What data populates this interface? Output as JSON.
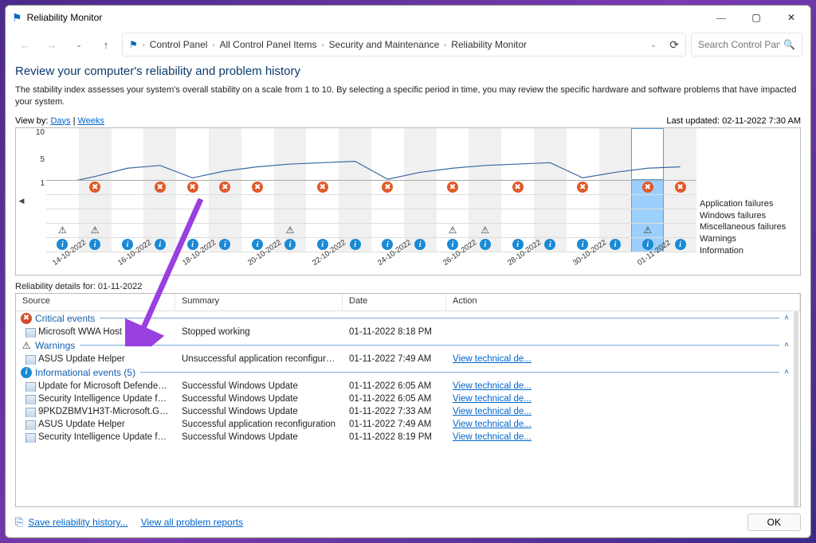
{
  "window": {
    "title": "Reliability Monitor"
  },
  "breadcrumb": [
    "Control Panel",
    "All Control Panel Items",
    "Security and Maintenance",
    "Reliability Monitor"
  ],
  "search": {
    "placeholder": "Search Control Panel"
  },
  "heading": "Review your computer's reliability and problem history",
  "description": "The stability index assesses your system's overall stability on a scale from 1 to 10. By selecting a specific period in time, you may review the specific hardware and software problems that have impacted your system.",
  "view_by_label": "View by:",
  "view_by_days": "Days",
  "view_by_weeks": "Weeks",
  "last_updated": "Last updated: 02-11-2022 7:30 AM",
  "legend": [
    "Application failures",
    "Windows failures",
    "Miscellaneous failures",
    "Warnings",
    "Information"
  ],
  "details_for": "Reliability details for: 01-11-2022",
  "columns": {
    "source": "Source",
    "summary": "Summary",
    "date": "Date",
    "action": "Action"
  },
  "groups": {
    "critical": "Critical events",
    "warnings": "Warnings",
    "info": "Informational events (5)"
  },
  "rows": {
    "critical": [
      {
        "source": "Microsoft WWA Host",
        "summary": "Stopped working",
        "date": "01-11-2022 8:18 PM",
        "action": ""
      }
    ],
    "warnings": [
      {
        "source": "ASUS Update Helper",
        "summary": "Unsuccessful application reconfiguration",
        "date": "01-11-2022 7:49 AM",
        "action": "View technical de..."
      }
    ],
    "info": [
      {
        "source": "Update for Microsoft Defender An...",
        "summary": "Successful Windows Update",
        "date": "01-11-2022 6:05 AM",
        "action": "View technical de..."
      },
      {
        "source": "Security Intelligence Update for M...",
        "summary": "Successful Windows Update",
        "date": "01-11-2022 6:05 AM",
        "action": "View technical de..."
      },
      {
        "source": "9PKDZBMV1H3T-Microsoft.GetHelp",
        "summary": "Successful Windows Update",
        "date": "01-11-2022 7:33 AM",
        "action": "View technical de..."
      },
      {
        "source": "ASUS Update Helper",
        "summary": "Successful application reconfiguration",
        "date": "01-11-2022 7:49 AM",
        "action": "View technical de..."
      },
      {
        "source": "Security Intelligence Update for M...",
        "summary": "Successful Windows Update",
        "date": "01-11-2022 8:19 PM",
        "action": "View technical de..."
      }
    ]
  },
  "footer": {
    "save": "Save reliability history...",
    "viewall": "View all problem reports",
    "ok": "OK"
  },
  "chart_data": {
    "type": "line",
    "dates": [
      "14-10-2022",
      "",
      "16-10-2022",
      "",
      "18-10-2022",
      "",
      "20-10-2022",
      "",
      "22-10-2022",
      "",
      "24-10-2022",
      "",
      "26-10-2022",
      "",
      "28-10-2022",
      "",
      "30-10-2022",
      "",
      "01-11-2022",
      ""
    ],
    "columns": 20,
    "ylim": [
      1,
      10
    ],
    "stability_index": [
      2.0,
      3.0,
      4.2,
      4.6,
      2.8,
      3.8,
      4.4,
      4.8,
      5.0,
      5.2,
      2.6,
      3.6,
      4.2,
      4.6,
      4.8,
      5.0,
      2.8,
      3.6,
      4.2,
      4.4
    ],
    "selected_col": 18,
    "app_failures_cols": [
      1,
      3,
      4,
      5,
      6,
      8,
      10,
      12,
      14,
      16,
      18,
      19
    ],
    "warnings_cols": [
      0,
      1,
      7,
      12,
      13,
      18
    ],
    "info_cols": [
      0,
      1,
      2,
      3,
      4,
      5,
      6,
      7,
      8,
      9,
      10,
      11,
      12,
      13,
      14,
      15,
      16,
      17,
      18,
      19
    ],
    "ylabel": "",
    "xlabel": ""
  }
}
